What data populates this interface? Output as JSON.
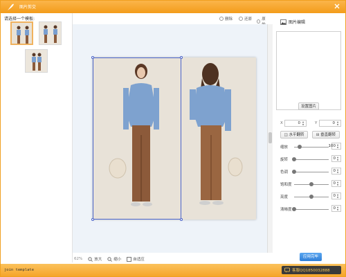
{
  "window": {
    "title": "图片剪交"
  },
  "left_panel": {
    "prompt": "请选择一个模板:"
  },
  "top_actions": [
    {
      "label": "删除"
    },
    {
      "label": "还原"
    },
    {
      "label": "原始"
    }
  ],
  "zoom": {
    "value": "62%",
    "zoom_in": "放大",
    "zoom_out": "缩小",
    "fit": "自适应"
  },
  "right_panel": {
    "header": "图片编辑",
    "set_image_button": "设置图片",
    "x_label": "X",
    "y_label": "Y",
    "x_value": "0",
    "y_value": "0",
    "flip_h": "水平翻转",
    "flip_v": "垂直翻转",
    "sliders": [
      {
        "label": "缩放",
        "value": "100",
        "level": 0.16
      },
      {
        "label": "旋转",
        "value": "0",
        "level": 0.0
      },
      {
        "label": "色调",
        "value": "0",
        "level": 0.0
      },
      {
        "label": "饱和度",
        "value": "0",
        "level": 0.5
      },
      {
        "label": "亮度",
        "value": "0",
        "level": 0.5
      },
      {
        "label": "清晰度",
        "value": "0",
        "level": 0.0
      }
    ],
    "confirm_button": "应用完毕"
  },
  "status": {
    "text": "join template",
    "login_label": "客服QQ1850032888"
  },
  "colors": {
    "accent": "#f39c1a",
    "selection": "#4a63c9",
    "confirm": "#2f7fd8"
  }
}
